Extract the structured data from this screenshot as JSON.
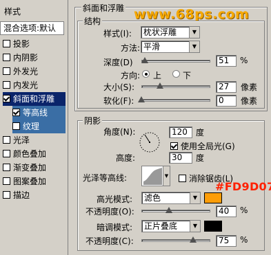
{
  "watermark": "www.68ps.com",
  "annotation": "#FD9D07",
  "left": {
    "title": "样式",
    "blend": "混合选项:默认",
    "items": [
      {
        "label": "投影",
        "checked": false
      },
      {
        "label": "内阴影",
        "checked": false
      },
      {
        "label": "外发光",
        "checked": false
      },
      {
        "label": "内发光",
        "checked": false
      },
      {
        "label": "斜面和浮雕",
        "checked": true
      },
      {
        "label": "等高线",
        "checked": true
      },
      {
        "label": "纹理",
        "checked": false
      },
      {
        "label": "光泽",
        "checked": false
      },
      {
        "label": "颜色叠加",
        "checked": false
      },
      {
        "label": "渐变叠加",
        "checked": false
      },
      {
        "label": "图案叠加",
        "checked": false
      },
      {
        "label": "描边",
        "checked": false
      }
    ]
  },
  "bevel": {
    "title": "斜面和浮雕",
    "structure": "结构",
    "style_label": "样式(I):",
    "style_value": "枕状浮雕",
    "method_label": "方法:",
    "method_value": "平滑",
    "depth_label": "深度(D)",
    "depth_value": "51",
    "depth_unit": "%",
    "depth_level": 0.05,
    "direction_label": "方向:",
    "dir_up": "上",
    "dir_down": "下",
    "direction": "上",
    "size_label": "大小(S):",
    "size_value": "27",
    "size_unit": "像素",
    "size_level": 0.27,
    "soften_label": "软化(F):",
    "soften_value": "0",
    "soften_unit": "像素",
    "soften_level": 0
  },
  "shading": {
    "title": "阴影",
    "angle_label": "角度(N):",
    "angle_value": "120",
    "angle_unit": "度",
    "global_label": "使用全局光(G)",
    "global_checked": true,
    "altitude_label": "高度:",
    "altitude_value": "30",
    "altitude_unit": "度",
    "gloss_label": "光泽等高线:",
    "antialias_label": "消除锯齿(L)",
    "antialias_checked": false,
    "highlight_label": "高光模式:",
    "highlight_value": "滤色",
    "highlight_color": "#FD9D07",
    "hl_opacity_label": "不透明度(O):",
    "hl_opacity_value": "40",
    "hl_opacity_unit": "%",
    "hl_opacity_level": 0.4,
    "shadow_label": "暗调模式:",
    "shadow_value": "正片叠底",
    "shadow_color": "#000000",
    "sh_opacity_label": "不透明度(C):",
    "sh_opacity_value": "75",
    "sh_opacity_unit": "%",
    "sh_opacity_level": 0.75
  }
}
